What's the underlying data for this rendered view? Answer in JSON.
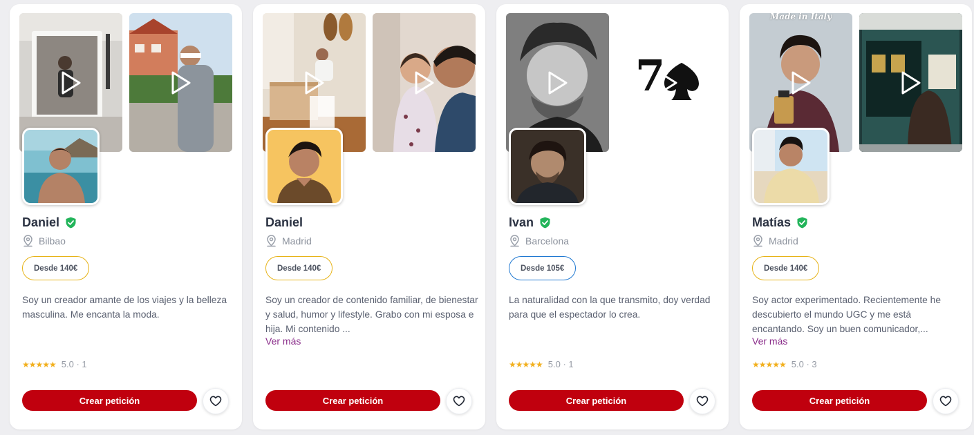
{
  "colors": {
    "primary_button": "#c0000e",
    "verified_badge": "#22b45a",
    "price_border_gold": "#e7b317",
    "price_border_blue": "#1f78d1",
    "star": "#f2b01e",
    "link": "#8a2d8a"
  },
  "icons": {
    "play": "play-icon",
    "verified": "verified-shield-icon",
    "location": "map-pin-icon",
    "favorite": "heart-outline-icon"
  },
  "cards": [
    {
      "name": "Daniel",
      "verified": true,
      "city": "Bilbao",
      "price": "Desde 140€",
      "description": "Soy un creador amante de los viajes y la belleza masculina. Me encanta la moda.",
      "show_more": "",
      "stars": "★★★★★",
      "score": "5.0 · 1",
      "cta": "Crear petición"
    },
    {
      "name": "Daniel",
      "verified": false,
      "city": "Madrid",
      "price": "Desde 140€",
      "description": "Soy un creador de contenido familiar, de bienestar y salud, humor y lifestyle. Grabo con mi esposa e hija. Mi contenido ...",
      "show_more": "Ver más",
      "stars": "",
      "score": "",
      "cta": "Crear petición"
    },
    {
      "name": "Ivan",
      "verified": true,
      "city": "Barcelona",
      "price": "Desde 105€",
      "description": "La naturalidad con la que transmito, doy verdad para que el espectador lo crea.",
      "show_more": "",
      "stars": "★★★★★",
      "score": "5.0 · 1",
      "cta": "Crear petición",
      "video_text": "7"
    },
    {
      "name": "Matías",
      "verified": true,
      "city": "Madrid",
      "price": "Desde 140€",
      "description": "Soy actor experimentado. Recientemente he descubierto el mundo UGC y me está encantando. Soy un buen comunicador,...",
      "show_more": "Ver más",
      "stars": "★★★★★",
      "score": "5.0 · 3",
      "cta": "Crear petición",
      "video_text": "Made in Italy"
    }
  ]
}
